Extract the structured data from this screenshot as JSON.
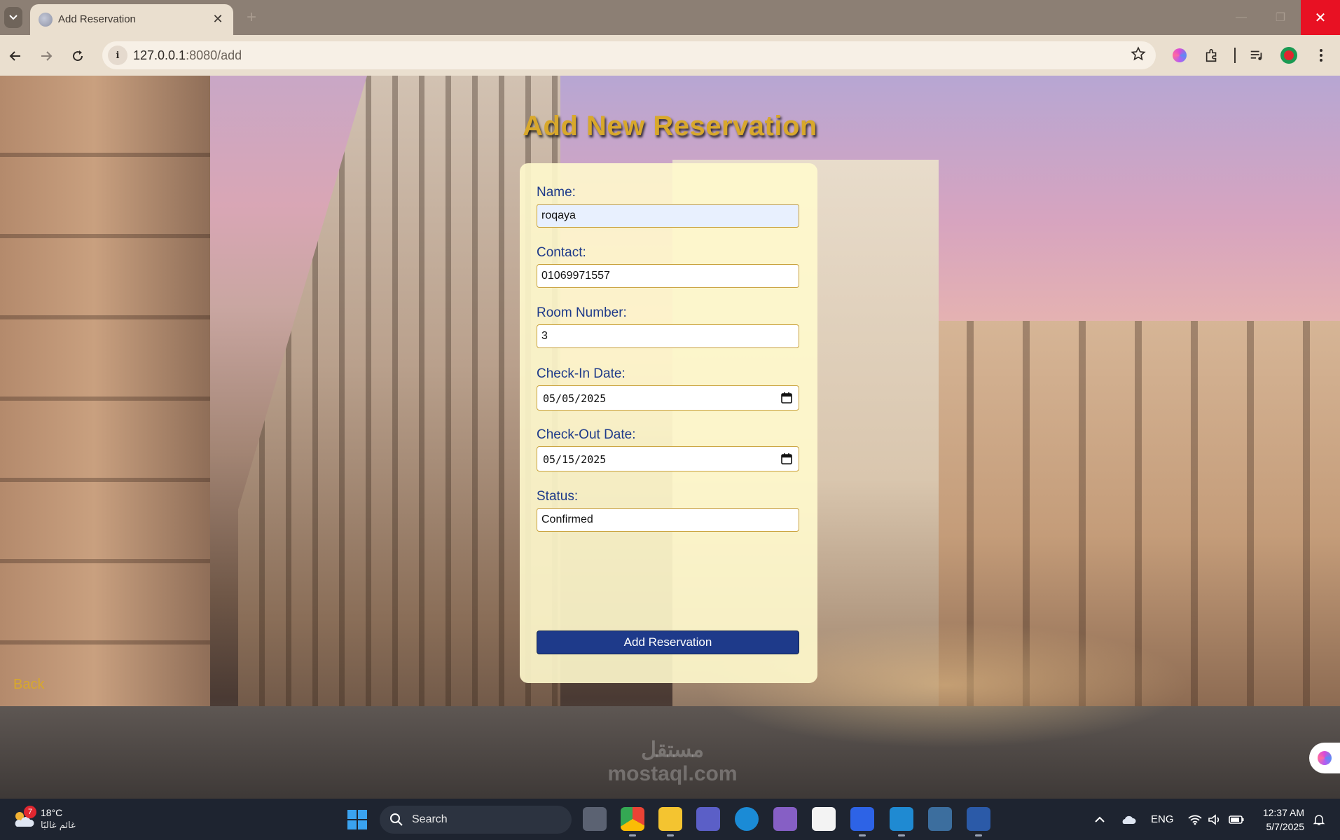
{
  "browser": {
    "tab_title": "Add Reservation",
    "tab_close_glyph": "✕",
    "new_tab_glyph": "+",
    "url_host": "127.0.0.1",
    "url_path": ":8080/add",
    "win_min_glyph": "—",
    "win_max_glyph": "❐",
    "win_close_glyph": "✕"
  },
  "page": {
    "heading": "Add New Reservation",
    "back_label": "Back",
    "form": {
      "name_label": "Name:",
      "name_value": "roqaya",
      "contact_label": "Contact:",
      "contact_value": "01069971557",
      "room_label": "Room Number:",
      "room_value": "3",
      "checkin_label": "Check-In Date:",
      "checkin_value": "05/05/2025",
      "checkout_label": "Check-Out Date:",
      "checkout_value": "05/15/2025",
      "status_label": "Status:",
      "status_value": "Confirmed",
      "submit_label": "Add Reservation"
    },
    "watermark": "مستقل mostaql.com"
  },
  "taskbar": {
    "weather_temp": "18°C",
    "weather_desc": "غائم غالبًا",
    "weather_badge": "7",
    "search_label": "Search",
    "language": "ENG",
    "time": "12:37 AM",
    "date": "5/7/2025"
  },
  "colors": {
    "heading": "#d8a82b",
    "label": "#1e3a8a",
    "button": "#1e3a8a",
    "card": "#fffacd"
  },
  "icons": [
    "tab-list-icon",
    "globe-icon",
    "close-icon",
    "back-arrow-icon",
    "forward-arrow-icon",
    "reload-icon",
    "site-info-icon",
    "star-icon",
    "gemini-icon",
    "extensions-icon",
    "media-icon",
    "profile-icon",
    "menu-icon",
    "calendar-icon",
    "windows-start-icon",
    "search-icon",
    "wifi-icon",
    "volume-icon",
    "battery-icon",
    "cloud-icon",
    "chevron-up-icon",
    "notification-icon"
  ]
}
